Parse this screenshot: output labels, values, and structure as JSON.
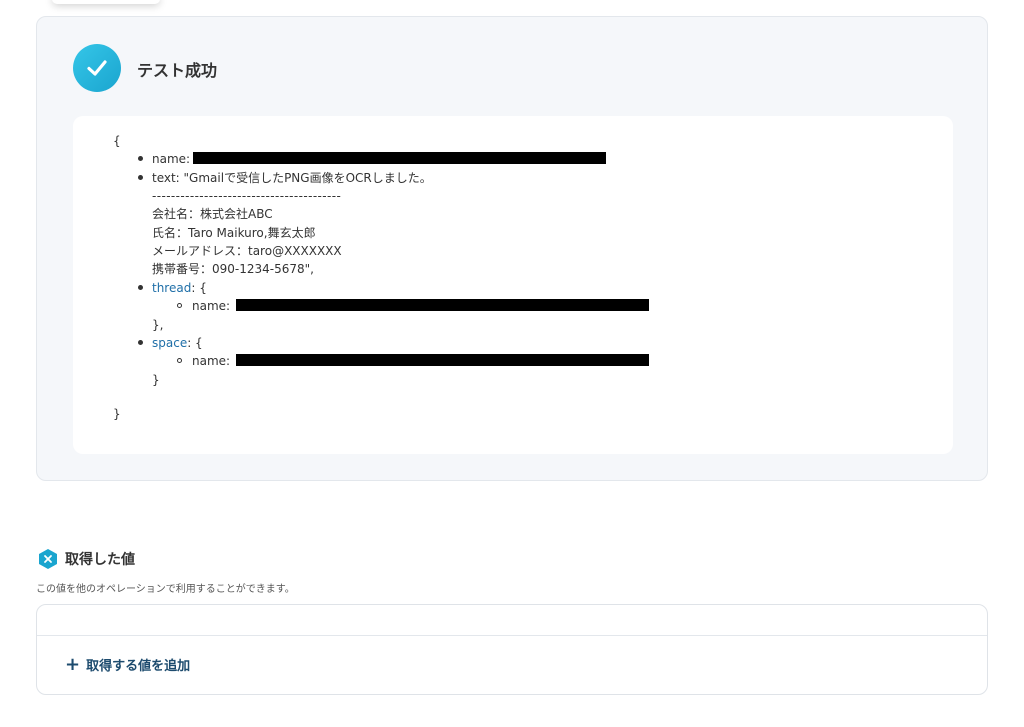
{
  "test_result": {
    "title": "テスト成功",
    "json_open": "{",
    "json_close": "}",
    "fields": {
      "name_key": "name:",
      "text_line": "text: \"Gmailで受信したPNG画像をOCRしました。",
      "separator": "----------------------------------------",
      "company": "会社名：株式会社ABC",
      "person": "氏名：Taro Maikuro,舞玄太郎",
      "email": "メールアドレス：taro@XXXXXXX",
      "phone": "携帯番号：090-1234-5678\",",
      "thread_key": "thread",
      "thread_open": ": {",
      "thread_name_key": "name:",
      "thread_close": "},",
      "space_key": "space",
      "space_open": ": {",
      "space_name_key": "name:",
      "space_close": "}"
    }
  },
  "acquired_values": {
    "title": "取得した値",
    "description": "この値を他のオペレーションで利用することができます。",
    "add_button_label": "取得する値を追加"
  },
  "colors": {
    "success_accent": "#1aa5cf",
    "link": "#1f6fa8",
    "button_text": "#1d4b6e"
  }
}
